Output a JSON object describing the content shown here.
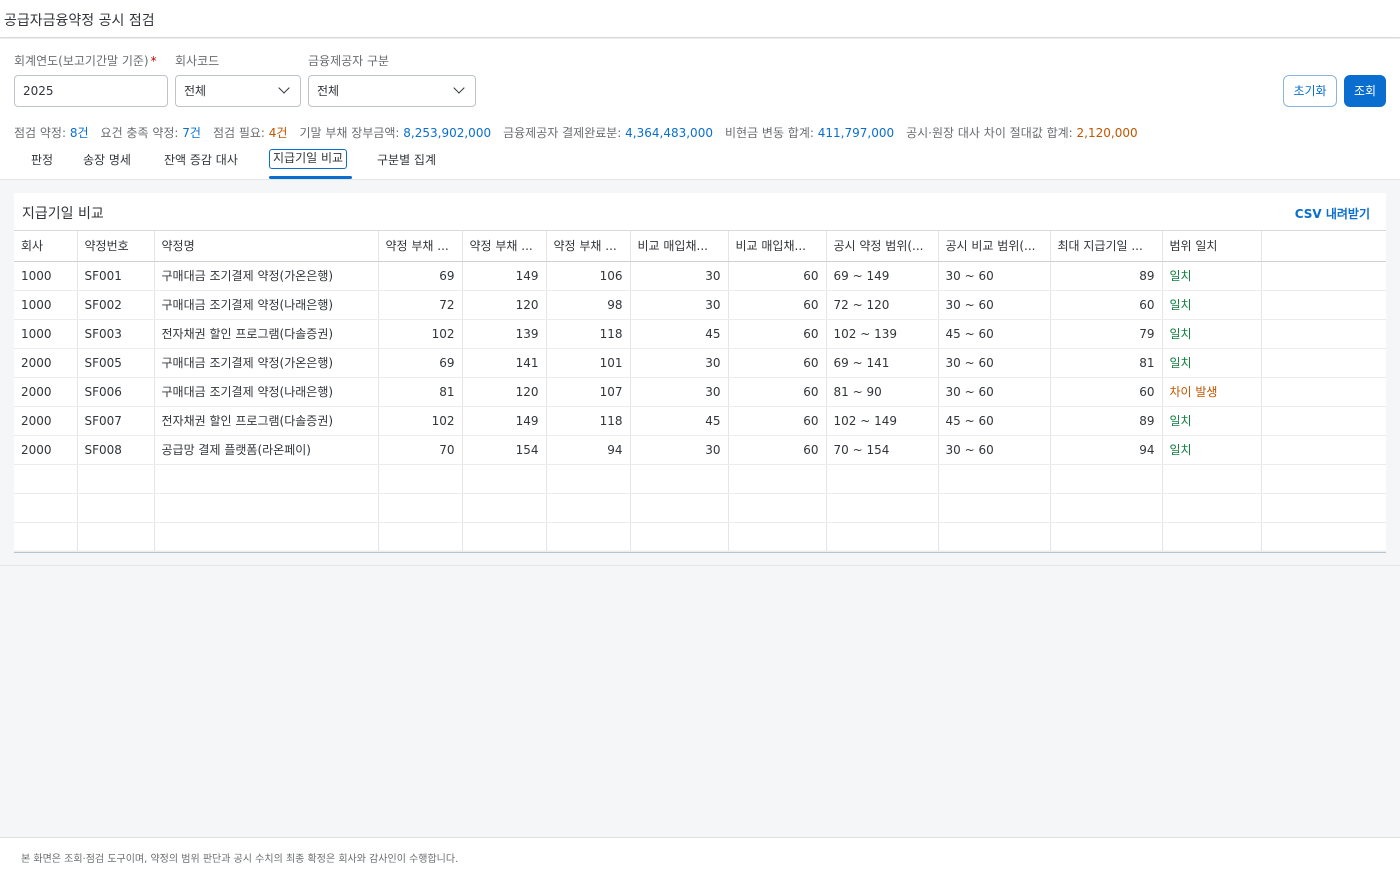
{
  "app": {
    "title": "공급자금융약정 공시 점검"
  },
  "filters": {
    "fiscal_year": {
      "label": "회계연도(보고기간말 기준)",
      "required_mark": "*",
      "value": "2025"
    },
    "company_code": {
      "label": "회사코드",
      "value": "전체"
    },
    "provider_type": {
      "label": "금융제공자 구분",
      "value": "전체"
    }
  },
  "actions": {
    "reset_label": "초기화",
    "search_label": "조회"
  },
  "summary": [
    {
      "label": "점검 약정: ",
      "value": "8건",
      "color": "#0a6ed1"
    },
    {
      "label": "요건 충족 약정: ",
      "value": "7건",
      "color": "#0a6ed1"
    },
    {
      "label": "점검 필요: ",
      "value": "4건",
      "color": "#c35500"
    },
    {
      "label": "기말 부채 장부금액: ",
      "value": "8,253,902,000",
      "color": "#0a6ed1"
    },
    {
      "label": "금융제공자 결제완료분: ",
      "value": "4,364,483,000",
      "color": "#0a6ed1"
    },
    {
      "label": "비현금 변동 합계: ",
      "value": "411,797,000",
      "color": "#0a6ed1"
    },
    {
      "label": "공시·원장 대사 차이 절대값 합계: ",
      "value": "2,120,000",
      "color": "#c35500"
    }
  ],
  "tabs": [
    {
      "label": "판정",
      "active": false
    },
    {
      "label": "송장 명세",
      "active": false
    },
    {
      "label": "잔액 증감 대사",
      "active": false
    },
    {
      "label": "지급기일 비교",
      "active": true
    },
    {
      "label": "구분별 집계",
      "active": false
    }
  ],
  "panel": {
    "title": "지급기일 비교",
    "csv_label": "CSV 내려받기"
  },
  "table": {
    "columns": [
      "회사",
      "약정번호",
      "약정명",
      "약정 부채 ...",
      "약정 부채 ...",
      "약정 부채 ...",
      "비교 매입채...",
      "비교 매입채...",
      "공시 약정 범위(...",
      "공시 비교 범위(...",
      "최대 지급기일 ...",
      "범위 일치"
    ],
    "rows": [
      [
        "1000",
        "SF001",
        "구매대금 조기결제 약정(가온은행)",
        "69",
        "149",
        "106",
        "30",
        "60",
        "69 ~ 149",
        "30 ~ 60",
        "89",
        "일치"
      ],
      [
        "1000",
        "SF002",
        "구매대금 조기결제 약정(나래은행)",
        "72",
        "120",
        "98",
        "30",
        "60",
        "72 ~ 120",
        "30 ~ 60",
        "60",
        "일치"
      ],
      [
        "1000",
        "SF003",
        "전자채권 할인 프로그램(다솔증권)",
        "102",
        "139",
        "118",
        "45",
        "60",
        "102 ~ 139",
        "45 ~ 60",
        "79",
        "일치"
      ],
      [
        "2000",
        "SF005",
        "구매대금 조기결제 약정(가온은행)",
        "69",
        "141",
        "101",
        "30",
        "60",
        "69 ~ 141",
        "30 ~ 60",
        "81",
        "일치"
      ],
      [
        "2000",
        "SF006",
        "구매대금 조기결제 약정(나래은행)",
        "81",
        "120",
        "107",
        "30",
        "60",
        "81 ~ 90",
        "30 ~ 60",
        "60",
        "차이 발생"
      ],
      [
        "2000",
        "SF007",
        "전자채권 할인 프로그램(다솔증권)",
        "102",
        "149",
        "118",
        "45",
        "60",
        "102 ~ 149",
        "45 ~ 60",
        "89",
        "일치"
      ],
      [
        "2000",
        "SF008",
        "공급망 결제 플랫폼(라온페이)",
        "70",
        "154",
        "94",
        "30",
        "60",
        "70 ~ 154",
        "30 ~ 60",
        "94",
        "일치"
      ]
    ],
    "match_colors": {
      "일치": "#107e3e",
      "차이 발생": "#c35500"
    }
  },
  "footer": {
    "note": "본 화면은 조회·점검 도구이며, 약정의 범위 판단과 공시 수치의 최종 확정은 회사와 감사인이 수행합니다."
  }
}
